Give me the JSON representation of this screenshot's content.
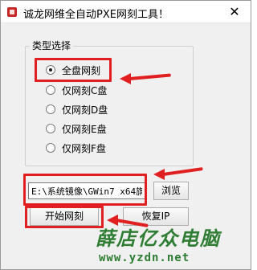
{
  "window": {
    "title": "诚龙网维全自动PXE网刻工具！",
    "close_glyph": "✕"
  },
  "group": {
    "legend": "类型选择",
    "options": [
      {
        "label": "全盘网刻",
        "checked": true
      },
      {
        "label": "仅网刻C盘",
        "checked": false
      },
      {
        "label": "仅网刻D盘",
        "checked": false
      },
      {
        "label": "仅网刻E盘",
        "checked": false
      },
      {
        "label": "仅网刻F盘",
        "checked": false
      }
    ]
  },
  "path": {
    "value": "E:\\系统镜像\\GWin7 x64旗"
  },
  "buttons": {
    "browse": "浏览",
    "start": "开始网刻",
    "restore_ip": "恢复IP"
  },
  "watermark": {
    "name": "薛店亿众电脑",
    "url": "www.yzdn.net"
  },
  "colors": {
    "highlight": "#e02020",
    "watermark": "#2e7d32"
  }
}
